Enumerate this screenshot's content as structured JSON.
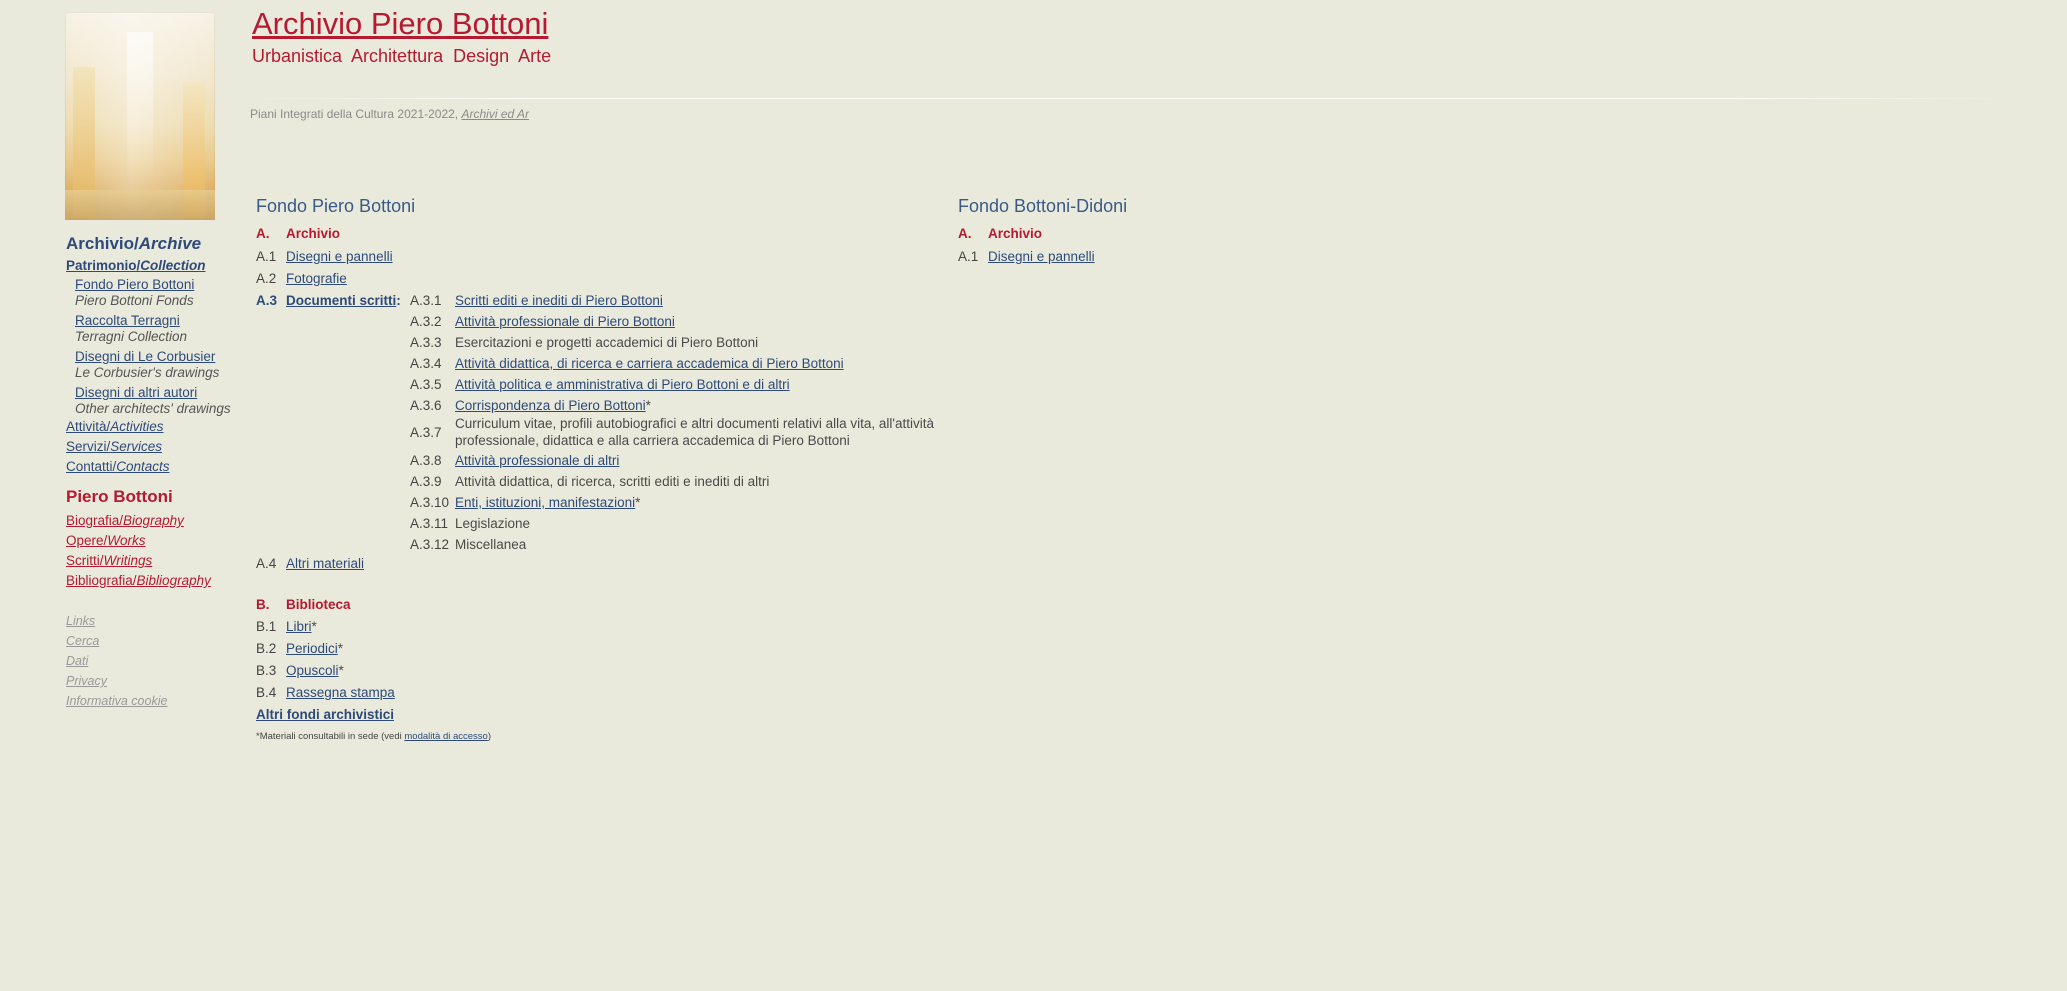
{
  "header": {
    "title": "Archivio Piero Bottoni",
    "subtitle": "Urbanistica Architettura Design Arte",
    "pic_text": "Piani Integrati della Cultura 2021-2022,",
    "pic_link": "Archivi ed Ar"
  },
  "sidebar": {
    "archive_it": "Archivio/",
    "archive_en": "Archive",
    "collection_it": "Patrimonio/",
    "collection_en": "Collection",
    "collection_items": [
      {
        "label": "Fondo Piero Bottoni",
        "en": "Piero Bottoni Fonds"
      },
      {
        "label": "Raccolta Terragni",
        "en": "Terragni Collection"
      },
      {
        "label": "Disegni di Le Corbusier",
        "en": "Le Corbusier's drawings"
      },
      {
        "label": "Disegni di altri autori",
        "en": "Other architects' drawings"
      }
    ],
    "links": [
      {
        "it": "Attività/",
        "en": "Activities"
      },
      {
        "it": "Servizi/",
        "en": "Services"
      },
      {
        "it": "Contatti/",
        "en": "Contacts"
      }
    ],
    "bottoni_title": "Piero Bottoni",
    "bottoni_links": [
      {
        "it": "Biografia/",
        "en": "Biography"
      },
      {
        "it": "Opere/",
        "en": "Works"
      },
      {
        "it": "Scritti/",
        "en": "Writings"
      },
      {
        "it": "Bibliografia/",
        "en": "Bibliography"
      }
    ],
    "footer_links": [
      "Links",
      "Cerca",
      "Dati",
      "Privacy",
      "Informativa cookie"
    ]
  },
  "fondo_bottoni": {
    "title": "Fondo Piero Bottoni",
    "section_a_code": "A.",
    "section_a_label": "Archivio",
    "a1_code": "A.1",
    "a1_label": "Disegni e pannelli",
    "a2_code": "A.2",
    "a2_label": "Fotografie",
    "a3_code": "A.3",
    "a3_label": "Documenti scritti",
    "a3_sub": [
      {
        "code": "A.3.1",
        "label": "Scritti editi e inediti di Piero Bottoni",
        "link": true
      },
      {
        "code": "A.3.2",
        "label": "Attività professionale di Piero Bottoni",
        "link": true
      },
      {
        "code": "A.3.3",
        "label": "Esercitazioni e progetti accademici di Piero Bottoni",
        "link": false
      },
      {
        "code": "A.3.4",
        "label": "Attività didattica, di ricerca e carriera accademica di Piero Bottoni",
        "link": true
      },
      {
        "code": "A.3.5",
        "label": "Attività politica e amministrativa di Piero Bottoni e di altri",
        "link": true
      },
      {
        "code": "A.3.6",
        "label": "Corrispondenza di Piero Bottoni",
        "link": true,
        "star": "*"
      },
      {
        "code": "A.3.7",
        "label": "Curriculum vitae, profili autobiografici e altri documenti relativi alla vita, all'attività",
        "label2": "professionale, didattica e alla carriera accademica di Piero Bottoni",
        "link": false
      },
      {
        "code": "A.3.8",
        "label": "Attività professionale di altri",
        "link": true
      },
      {
        "code": "A.3.9",
        "label": "Attività didattica, di ricerca, scritti editi e inediti di altri",
        "link": false
      },
      {
        "code": "A.3.10",
        "label": "Enti, istituzioni, manifestazioni",
        "link": true,
        "star": "*"
      },
      {
        "code": "A.3.11",
        "label": "Legislazione",
        "link": false
      },
      {
        "code": "A.3.12",
        "label": "Miscellanea",
        "link": false
      }
    ],
    "a4_code": "A.4",
    "a4_label": "Altri materiali",
    "section_b_code": "B.",
    "section_b_label": "Biblioteca",
    "b_items": [
      {
        "code": "B.1",
        "label": "Libri",
        "star": "*"
      },
      {
        "code": "B.2",
        "label": "Periodici",
        "star": "*"
      },
      {
        "code": "B.3",
        "label": "Opuscoli",
        "star": "*"
      },
      {
        "code": "B.4",
        "label": "Rassegna stampa",
        "star": ""
      }
    ],
    "altri_fondi": "Altri fondi archivistici",
    "note_text": "*Materiali consultabili in sede (vedi",
    "note_link": "modalità di accesso",
    "note_end": ")"
  },
  "fondo_didoni": {
    "title": "Fondo Bottoni-Didoni",
    "section_a_code": "A.",
    "section_a_label": "Archivio",
    "a1_code": "A.1",
    "a1_label": "Disegni e pannelli"
  }
}
